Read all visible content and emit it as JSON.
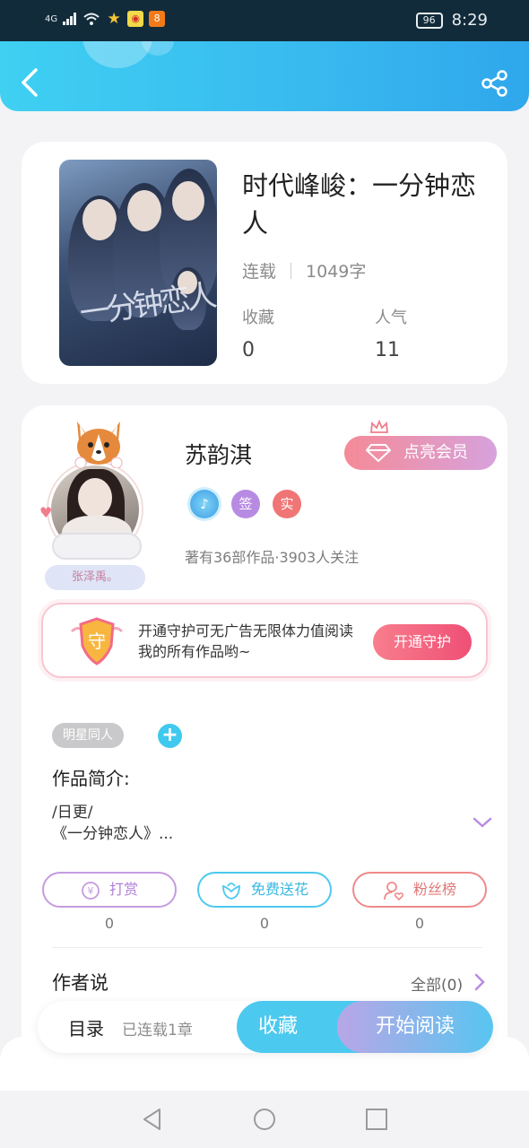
{
  "status_bar": {
    "signal": "4G",
    "battery": "96",
    "time": "8:29"
  },
  "header": {
    "back_icon": "chevron-left-icon",
    "share_icon": "share-icon"
  },
  "book": {
    "title": "时代峰峻：一分钟恋人",
    "cover_text": "一分钟恋人",
    "status": "连载",
    "word_count": "1049字",
    "favorites_label": "收藏",
    "favorites_value": "0",
    "popularity_label": "人气",
    "popularity_value": "11"
  },
  "author": {
    "name": "苏韵淇",
    "name_plate": "张泽禹。",
    "vip_label": "点亮会员",
    "badges": [
      "签",
      "实"
    ],
    "stats": "著有36部作品·3903人关注"
  },
  "guard": {
    "shield_char": "守",
    "text": "开通守护可无广告无限体力值阅读我的所有作品哟~",
    "button": "开通守护"
  },
  "tags": {
    "tag1": "明星同人",
    "add": "+"
  },
  "intro": {
    "title": "作品简介:",
    "line1": "/日更/",
    "line2": "《一分钟恋人》..."
  },
  "actions": [
    {
      "label": "打赏",
      "count": "0",
      "color": "#c59be0"
    },
    {
      "label": "免费送花",
      "count": "0",
      "color": "#4cc9ee"
    },
    {
      "label": "粉丝榜",
      "count": "0",
      "color": "#ee8a8a"
    }
  ],
  "author_says": {
    "title": "作者说",
    "all": "全部(0)"
  },
  "bottom_bar": {
    "toc": "目录",
    "chapters": "已连载1章",
    "favorite": "收藏",
    "read": "开始阅读"
  },
  "colors": {
    "accent": "#3fc9ef",
    "vip_pink": "#f58a97",
    "guard_red": "#ef4f76"
  }
}
